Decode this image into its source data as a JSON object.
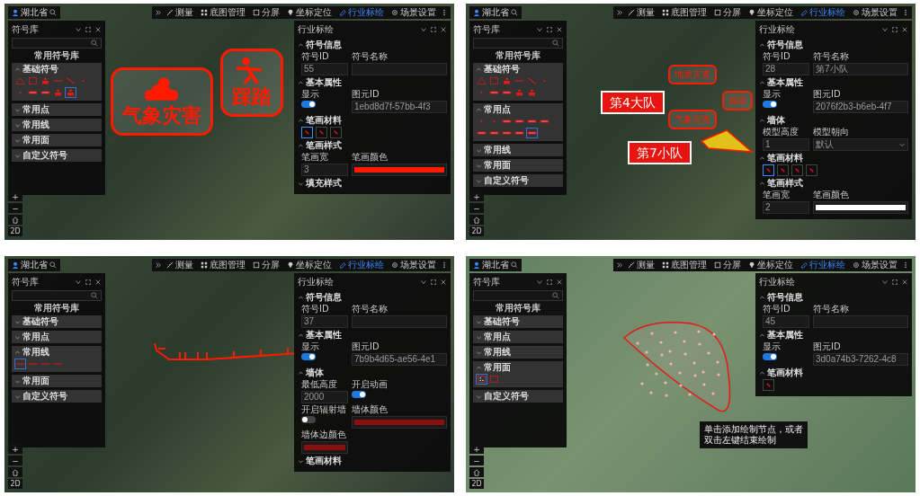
{
  "screens": [
    {
      "map": {
        "kind": "satellite"
      },
      "location": "湖北省",
      "toolbar": [
        {
          "kind": "measure",
          "label": "测量",
          "selected": false
        },
        {
          "kind": "basemap",
          "label": "底图管理",
          "selected": false
        },
        {
          "kind": "split",
          "label": "分屏",
          "selected": false
        },
        {
          "kind": "locate",
          "label": "坐标定位",
          "selected": false
        },
        {
          "kind": "plot",
          "label": "行业标绘",
          "selected": true
        },
        {
          "kind": "settings",
          "label": "场景设置",
          "selected": false
        }
      ],
      "overlays": [
        {
          "kind": "weather",
          "text": "气象灾害"
        },
        {
          "kind": "stampede",
          "text": "踩踏"
        }
      ],
      "left_panel": {
        "title": "符号库",
        "library_title": "常用符号库",
        "groups": [
          {
            "label": "基础符号",
            "expanded": true,
            "symbols": [
              {
                "kind": "triangle",
                "selected": false
              },
              {
                "kind": "square",
                "selected": false
              },
              {
                "kind": "figure",
                "selected": false
              },
              {
                "kind": "line",
                "selected": false
              },
              {
                "kind": "slash",
                "selected": false
              },
              {
                "kind": "dot",
                "selected": false
              },
              {
                "kind": "dot",
                "selected": false
              },
              {
                "kind": "bar",
                "selected": false
              },
              {
                "kind": "bar",
                "selected": false
              },
              {
                "kind": "figure",
                "selected": false
              },
              {
                "kind": "figure",
                "selected": true
              }
            ]
          },
          {
            "label": "常用点",
            "expanded": false
          },
          {
            "label": "常用线",
            "expanded": false
          },
          {
            "label": "常用面",
            "expanded": false
          },
          {
            "label": "自定义符号",
            "expanded": false
          }
        ]
      },
      "right_panel": {
        "title": "行业标绘",
        "sections": [
          {
            "title": "符号信息",
            "expanded": true,
            "fields": [
              {
                "kind": "text",
                "label": "符号ID",
                "value": "55"
              },
              {
                "kind": "text",
                "label": "符号名称"
              }
            ]
          },
          {
            "title": "基本属性",
            "expanded": true,
            "fields": [
              {
                "kind": "toggle",
                "label": "显示",
                "on": true
              },
              {
                "kind": "text",
                "label": "图元ID",
                "value": "1ebd8d7f-57bb-4f3"
              }
            ]
          },
          {
            "title": "笔画材料",
            "expanded": true,
            "fields": [
              {
                "kind": "swatches",
                "items": [
                  {
                    "selected": true
                  },
                  {
                    "selected": false
                  },
                  {
                    "selected": false
                  }
                ]
              }
            ]
          },
          {
            "title": "笔画样式",
            "expanded": true,
            "fields": [
              {
                "kind": "text",
                "label": "笔画宽",
                "value": "3"
              },
              {
                "kind": "color",
                "label": "笔画颜色",
                "color": "#ff1a00"
              }
            ]
          },
          {
            "title": "填充样式",
            "expanded": false
          }
        ]
      },
      "map_controls": {
        "zoom_in": "+",
        "zoom_out": "−",
        "mode": "2D"
      }
    },
    {
      "map": {
        "kind": "satellite"
      },
      "location": "湖北省",
      "toolbar": [
        {
          "kind": "measure",
          "label": "测量",
          "selected": false
        },
        {
          "kind": "basemap",
          "label": "底图管理",
          "selected": false
        },
        {
          "kind": "split",
          "label": "分屏",
          "selected": false
        },
        {
          "kind": "locate",
          "label": "坐标定位",
          "selected": false
        },
        {
          "kind": "plot",
          "label": "行业标绘",
          "selected": true
        },
        {
          "kind": "settings",
          "label": "场景设置",
          "selected": false
        }
      ],
      "overlays": [
        {
          "kind": "unit",
          "text": "第4大队"
        },
        {
          "kind": "unit",
          "text": "第7小队"
        },
        {
          "kind": "small-hazard",
          "text": "地质灾害"
        },
        {
          "kind": "small-hazard",
          "text": "气象灾害"
        },
        {
          "kind": "small-hazard",
          "text": "踩踏"
        },
        {
          "kind": "prism"
        }
      ],
      "left_panel": {
        "title": "符号库",
        "library_title": "常用符号库",
        "groups": [
          {
            "label": "基础符号",
            "expanded": true,
            "symbols": [
              {
                "kind": "triangle",
                "selected": false
              },
              {
                "kind": "square",
                "selected": false
              },
              {
                "kind": "figure",
                "selected": false
              },
              {
                "kind": "line",
                "selected": false
              },
              {
                "kind": "slash",
                "selected": false
              },
              {
                "kind": "dot",
                "selected": false
              },
              {
                "kind": "dot",
                "selected": false
              },
              {
                "kind": "bar",
                "selected": false
              },
              {
                "kind": "bar",
                "selected": false
              },
              {
                "kind": "figure",
                "selected": false
              },
              {
                "kind": "figure",
                "selected": false
              }
            ]
          },
          {
            "label": "常用点",
            "expanded": true,
            "symbols": [
              {
                "kind": "dot",
                "selected": false
              },
              {
                "kind": "dot",
                "selected": false
              },
              {
                "kind": "bar",
                "selected": false
              },
              {
                "kind": "bar",
                "selected": false
              },
              {
                "kind": "bar",
                "selected": false
              },
              {
                "kind": "bar",
                "selected": false
              },
              {
                "kind": "bar",
                "selected": false
              },
              {
                "kind": "bar",
                "selected": false
              },
              {
                "kind": "bar",
                "selected": false
              },
              {
                "kind": "bar",
                "selected": false
              },
              {
                "kind": "bar",
                "selected": true
              }
            ]
          },
          {
            "label": "常用线",
            "expanded": false
          },
          {
            "label": "常用面",
            "expanded": false
          },
          {
            "label": "自定义符号",
            "expanded": false
          }
        ]
      },
      "right_panel": {
        "title": "行业标绘",
        "sections": [
          {
            "title": "符号信息",
            "expanded": true,
            "fields": [
              {
                "kind": "text",
                "label": "符号ID",
                "value": "28"
              },
              {
                "kind": "text",
                "label": "符号名称",
                "value": "第7小队"
              }
            ]
          },
          {
            "title": "基本属性",
            "expanded": true,
            "fields": [
              {
                "kind": "toggle",
                "label": "显示",
                "on": true
              },
              {
                "kind": "text",
                "label": "图元ID",
                "value": "2076f2b3-b6eb-4f7"
              }
            ]
          },
          {
            "title": "墙体",
            "expanded": true,
            "fields": [
              {
                "kind": "text",
                "label": "模型高度",
                "value": "1"
              },
              {
                "kind": "select",
                "label": "模型朝向",
                "value": "默认"
              }
            ]
          },
          {
            "title": "笔画材料",
            "expanded": true,
            "fields": [
              {
                "kind": "swatches",
                "items": [
                  {
                    "selected": true
                  },
                  {
                    "selected": false
                  },
                  {
                    "selected": false
                  },
                  {
                    "selected": false
                  }
                ]
              }
            ]
          },
          {
            "title": "笔画样式",
            "expanded": true,
            "fields": [
              {
                "kind": "text",
                "label": "笔画宽",
                "value": "2"
              },
              {
                "kind": "color",
                "label": "笔画颜色",
                "color": "#ffffff"
              }
            ]
          }
        ]
      },
      "map_controls": {
        "zoom_in": "+",
        "zoom_out": "−",
        "mode": "2D"
      }
    },
    {
      "map": {
        "kind": "satellite"
      },
      "location": "湖北省",
      "toolbar": [
        {
          "kind": "measure",
          "label": "测量",
          "selected": false
        },
        {
          "kind": "basemap",
          "label": "底图管理",
          "selected": false
        },
        {
          "kind": "split",
          "label": "分屏",
          "selected": false
        },
        {
          "kind": "locate",
          "label": "坐标定位",
          "selected": false
        },
        {
          "kind": "plot",
          "label": "行业标绘",
          "selected": true
        },
        {
          "kind": "settings",
          "label": "场景设置",
          "selected": false
        }
      ],
      "overlays": [
        {
          "kind": "route"
        }
      ],
      "left_panel": {
        "title": "符号库",
        "library_title": "常用符号库",
        "groups": [
          {
            "label": "基础符号",
            "expanded": false
          },
          {
            "label": "常用点",
            "expanded": false
          },
          {
            "label": "常用线",
            "expanded": true,
            "symbols": [
              {
                "kind": "line",
                "selected": true
              },
              {
                "kind": "line",
                "selected": false
              },
              {
                "kind": "line",
                "selected": false
              },
              {
                "kind": "line",
                "selected": false
              }
            ]
          },
          {
            "label": "常用面",
            "expanded": false
          },
          {
            "label": "自定义符号",
            "expanded": false
          }
        ]
      },
      "right_panel": {
        "title": "行业标绘",
        "sections": [
          {
            "title": "符号信息",
            "expanded": true,
            "fields": [
              {
                "kind": "text",
                "label": "符号ID",
                "value": "37"
              },
              {
                "kind": "text",
                "label": "符号名称"
              }
            ]
          },
          {
            "title": "基本属性",
            "expanded": true,
            "fields": [
              {
                "kind": "toggle",
                "label": "显示",
                "on": true
              },
              {
                "kind": "text",
                "label": "图元ID",
                "value": "7b9b4d65-ae56-4e1"
              }
            ]
          },
          {
            "title": "墙体",
            "expanded": true,
            "fields": [
              {
                "kind": "text",
                "label": "最低高度",
                "value": "2000"
              },
              {
                "kind": "toggle",
                "label": "开启动画",
                "on": true
              },
              {
                "kind": "toggle",
                "label": "开启辐射墙",
                "on": false
              },
              {
                "kind": "color",
                "label": "墙体颜色",
                "color": "#8b1010"
              },
              {
                "kind": "color",
                "label": "墙体边颜色",
                "color": "#8b1010"
              }
            ]
          },
          {
            "title": "笔画材料",
            "expanded": false
          }
        ]
      },
      "map_controls": {
        "zoom_in": "+",
        "zoom_out": "−",
        "mode": "2D"
      }
    },
    {
      "map": {
        "kind": "terrain"
      },
      "location": "湖北省",
      "toolbar": [
        {
          "kind": "measure",
          "label": "测量",
          "selected": false
        },
        {
          "kind": "basemap",
          "label": "底图管理",
          "selected": false
        },
        {
          "kind": "split",
          "label": "分屏",
          "selected": false
        },
        {
          "kind": "locate",
          "label": "坐标定位",
          "selected": false
        },
        {
          "kind": "plot",
          "label": "行业标绘",
          "selected": true
        },
        {
          "kind": "settings",
          "label": "场景设置",
          "selected": false
        }
      ],
      "overlays": [
        {
          "kind": "area"
        },
        {
          "kind": "tooltip",
          "text": "单击添加绘制节点，或者双击左键结束绘制"
        }
      ],
      "left_panel": {
        "title": "符号库",
        "library_title": "常用符号库",
        "groups": [
          {
            "label": "基础符号",
            "expanded": false
          },
          {
            "label": "常用点",
            "expanded": false
          },
          {
            "label": "常用线",
            "expanded": false
          },
          {
            "label": "常用面",
            "expanded": true,
            "symbols": [
              {
                "kind": "dots",
                "selected": true
              },
              {
                "kind": "square",
                "selected": false
              }
            ]
          },
          {
            "label": "自定义符号",
            "expanded": false
          }
        ]
      },
      "right_panel": {
        "title": "行业标绘",
        "sections": [
          {
            "title": "符号信息",
            "expanded": true,
            "fields": [
              {
                "kind": "text",
                "label": "符号ID",
                "value": "45"
              },
              {
                "kind": "text",
                "label": "符号名称"
              }
            ]
          },
          {
            "title": "基本属性",
            "expanded": true,
            "fields": [
              {
                "kind": "toggle",
                "label": "显示",
                "on": true
              },
              {
                "kind": "text",
                "label": "图元ID",
                "value": "3d0a74b3-7262-4c8"
              }
            ]
          },
          {
            "title": "笔画材料",
            "expanded": true,
            "fields": [
              {
                "kind": "swatches",
                "items": [
                  {
                    "selected": false
                  }
                ]
              }
            ]
          }
        ]
      },
      "map_controls": {
        "zoom_in": "+",
        "zoom_out": "−",
        "mode": "2D"
      }
    }
  ]
}
